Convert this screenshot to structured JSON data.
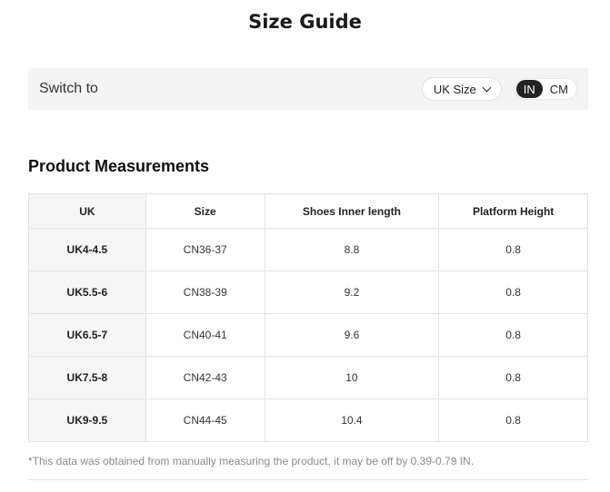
{
  "title": "Size Guide",
  "switch": {
    "label": "Switch to",
    "size_select": "UK Size",
    "units": [
      "IN",
      "CM"
    ],
    "active_unit": "IN"
  },
  "section": {
    "heading": "Product Measurements"
  },
  "table": {
    "headers": [
      "UK",
      "Size",
      "Shoes Inner length",
      "Platform Height"
    ],
    "rows": [
      [
        "UK4-4.5",
        "CN36-37",
        "8.8",
        "0.8"
      ],
      [
        "UK5.5-6",
        "CN38-39",
        "9.2",
        "0.8"
      ],
      [
        "UK6.5-7",
        "CN40-41",
        "9.6",
        "0.8"
      ],
      [
        "UK7.5-8",
        "CN42-43",
        "10",
        "0.8"
      ],
      [
        "UK9-9.5",
        "CN44-45",
        "10.4",
        "0.8"
      ]
    ]
  },
  "note": "*This data was obtained from manually measuring the product, it may be off by 0.39-0.79 IN.",
  "colors": {
    "active_toggle": "#222222",
    "bar_background": "#f4f4f4",
    "first_col": "#f6f6f6"
  },
  "icons": {
    "size_select": "chevron-down-icon"
  }
}
